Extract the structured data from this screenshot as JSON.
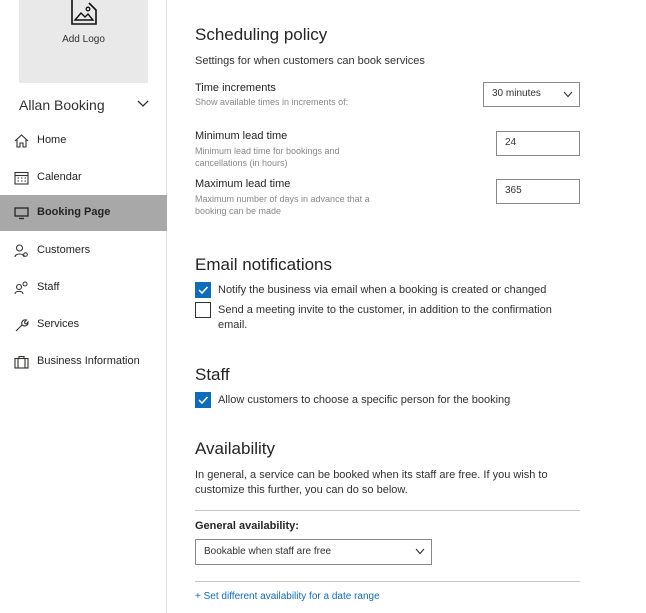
{
  "sidebar": {
    "logo_label": "Add Logo",
    "business_name": "Allan Booking",
    "items": [
      {
        "label": "Home",
        "icon": "home-icon"
      },
      {
        "label": "Calendar",
        "icon": "calendar-icon"
      },
      {
        "label": "Booking Page",
        "icon": "monitor-icon",
        "active": true
      },
      {
        "label": "Customers",
        "icon": "customers-icon"
      },
      {
        "label": "Staff",
        "icon": "staff-icon"
      },
      {
        "label": "Services",
        "icon": "wrench-icon"
      },
      {
        "label": "Business Information",
        "icon": "briefcase-icon"
      }
    ]
  },
  "scheduling": {
    "title": "Scheduling policy",
    "subtitle": "Settings for when customers can book services",
    "time_increments": {
      "label": "Time increments",
      "desc": "Show available times in increments of:",
      "value": "30 minutes"
    },
    "min_lead": {
      "label": "Minimum lead time",
      "desc_line1": "Minimum lead time for bookings and",
      "desc_line2": "cancellations (in hours)",
      "value": "24"
    },
    "max_lead": {
      "label": "Maximum lead time",
      "desc_line1": "Maximum number of days in advance that a",
      "desc_line2": "booking can be made",
      "value": "365"
    }
  },
  "email": {
    "title": "Email notifications",
    "notify_business": {
      "label": "Notify the business via email when a booking is created or changed",
      "checked": true
    },
    "meeting_invite": {
      "label_line1": "Send a meeting invite to the customer, in addition to the confirmation",
      "label_line2": "email.",
      "checked": false
    }
  },
  "staff": {
    "title": "Staff",
    "choose_person": {
      "label": "Allow customers to choose a specific person for the booking",
      "checked": true
    }
  },
  "availability": {
    "title": "Availability",
    "para_line1": "In general, a service can be booked when its staff are free. If you wish to",
    "para_line2": "customize this further, you can do so below.",
    "general_label": "General availability:",
    "general_value": "Bookable when staff are free",
    "date_range_link": "+ Set different availability for a date range"
  },
  "colors": {
    "accent": "#0f6cbd",
    "active_nav": "#a8a8a8"
  }
}
